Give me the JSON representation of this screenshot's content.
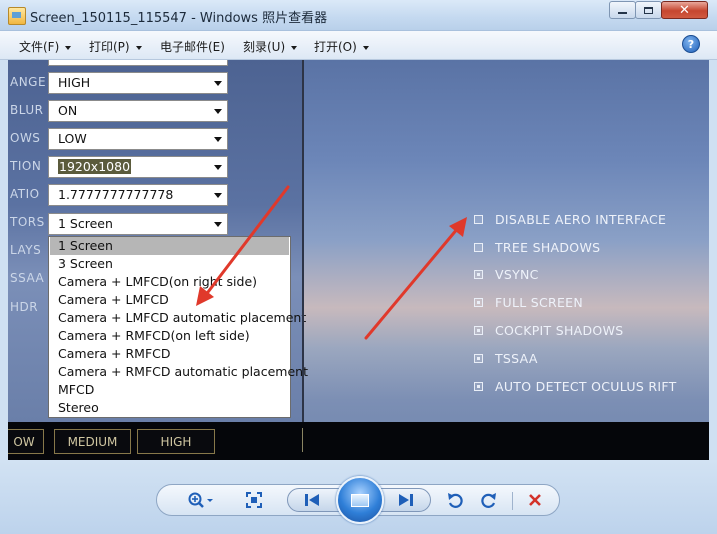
{
  "window": {
    "title": "Screen_150115_115547 - Windows 照片查看器",
    "min_icon": "minimize-icon",
    "max_icon": "maximize-icon",
    "close_glyph": "✕"
  },
  "menu": {
    "items": [
      {
        "label": "文件(F)"
      },
      {
        "label": "打印(P)"
      },
      {
        "label": "电子邮件(E)"
      },
      {
        "label": "刻录(U)"
      },
      {
        "label": "打开(O)"
      }
    ],
    "help_glyph": "?"
  },
  "settings": {
    "rows": [
      {
        "label": "ANGE",
        "value": "HIGH"
      },
      {
        "label": "BLUR",
        "value": "ON"
      },
      {
        "label": "OWS",
        "value": "LOW"
      },
      {
        "label": "TION",
        "value": "1920x1080"
      },
      {
        "label": "ATIO",
        "value": "1.7777777777778"
      },
      {
        "label": "TORS",
        "value": "1 Screen"
      },
      {
        "label": "LAYS"
      },
      {
        "label": "SSAA"
      },
      {
        "label": "HDR"
      }
    ]
  },
  "dropdown": {
    "selected_index": 0,
    "options": [
      "1 Screen",
      "3 Screen",
      "Camera + LMFCD(on right side)",
      "Camera + LMFCD",
      "Camera + LMFCD automatic placement",
      "Camera + RMFCD(on left side)",
      "Camera + RMFCD",
      "Camera + RMFCD automatic placement",
      "MFCD",
      "Stereo"
    ]
  },
  "quality_buttons": [
    "OW",
    "MEDIUM",
    "HIGH"
  ],
  "options": [
    {
      "label": "DISABLE AERO INTERFACE",
      "checked": false
    },
    {
      "label": "TREE SHADOWS",
      "checked": false
    },
    {
      "label": "VSYNC",
      "checked": true
    },
    {
      "label": "FULL SCREEN",
      "checked": true
    },
    {
      "label": "COCKPIT SHADOWS",
      "checked": true
    },
    {
      "label": "TSSAA",
      "checked": true
    },
    {
      "label": "AUTO DETECT OCULUS RIFT",
      "checked": true
    }
  ],
  "annotation_color": "#e0392b",
  "toolbar": {
    "zoom_icon": "zoom-icon",
    "fit_icon": "actual-size-icon",
    "prev_icon": "previous-icon",
    "slideshow_icon": "slideshow-icon",
    "next_icon": "next-icon",
    "rotate_ccw_icon": "rotate-counterclockwise-icon",
    "rotate_cw_icon": "rotate-clockwise-icon",
    "delete_icon": "delete-icon"
  }
}
